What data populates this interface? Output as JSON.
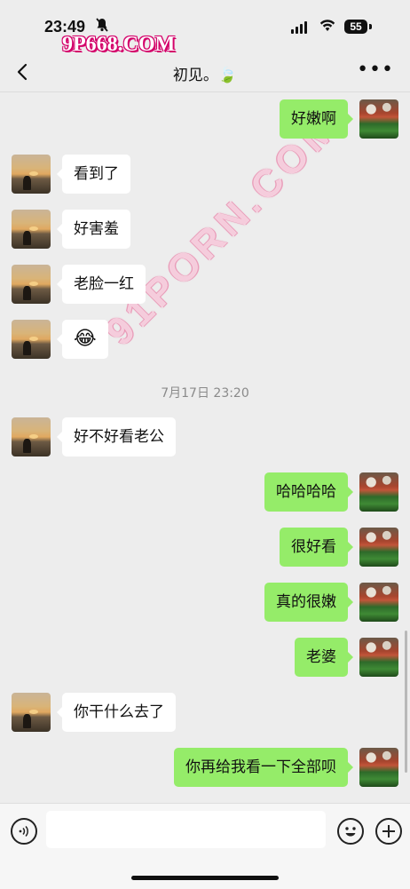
{
  "status_bar": {
    "time": "23:49",
    "battery": "55",
    "watermark": "9P668.COM"
  },
  "nav": {
    "title": "初见。🍃",
    "more_label": "•••"
  },
  "watermark_diagonal": "91PORN.COM",
  "messages": [
    {
      "side": "right",
      "text": "好嫩啊"
    },
    {
      "side": "left",
      "text": "看到了"
    },
    {
      "side": "left",
      "text": "好害羞"
    },
    {
      "side": "left",
      "text": "老脸一红"
    },
    {
      "side": "left",
      "text": "😂"
    },
    {
      "side": "left",
      "text": "好不好看老公"
    },
    {
      "side": "right",
      "text": "哈哈哈哈"
    },
    {
      "side": "right",
      "text": "很好看"
    },
    {
      "side": "right",
      "text": "真的很嫩"
    },
    {
      "side": "right",
      "text": "老婆"
    },
    {
      "side": "left",
      "text": "你干什么去了"
    },
    {
      "side": "right",
      "text": "你再给我看一下全部呗"
    }
  ],
  "timestamp": "7月17日 23:20",
  "input": {
    "value": "",
    "placeholder": ""
  },
  "colors": {
    "chat_background": "#ededed",
    "outgoing_bubble": "#95ec69",
    "incoming_bubble": "#ffffff"
  }
}
